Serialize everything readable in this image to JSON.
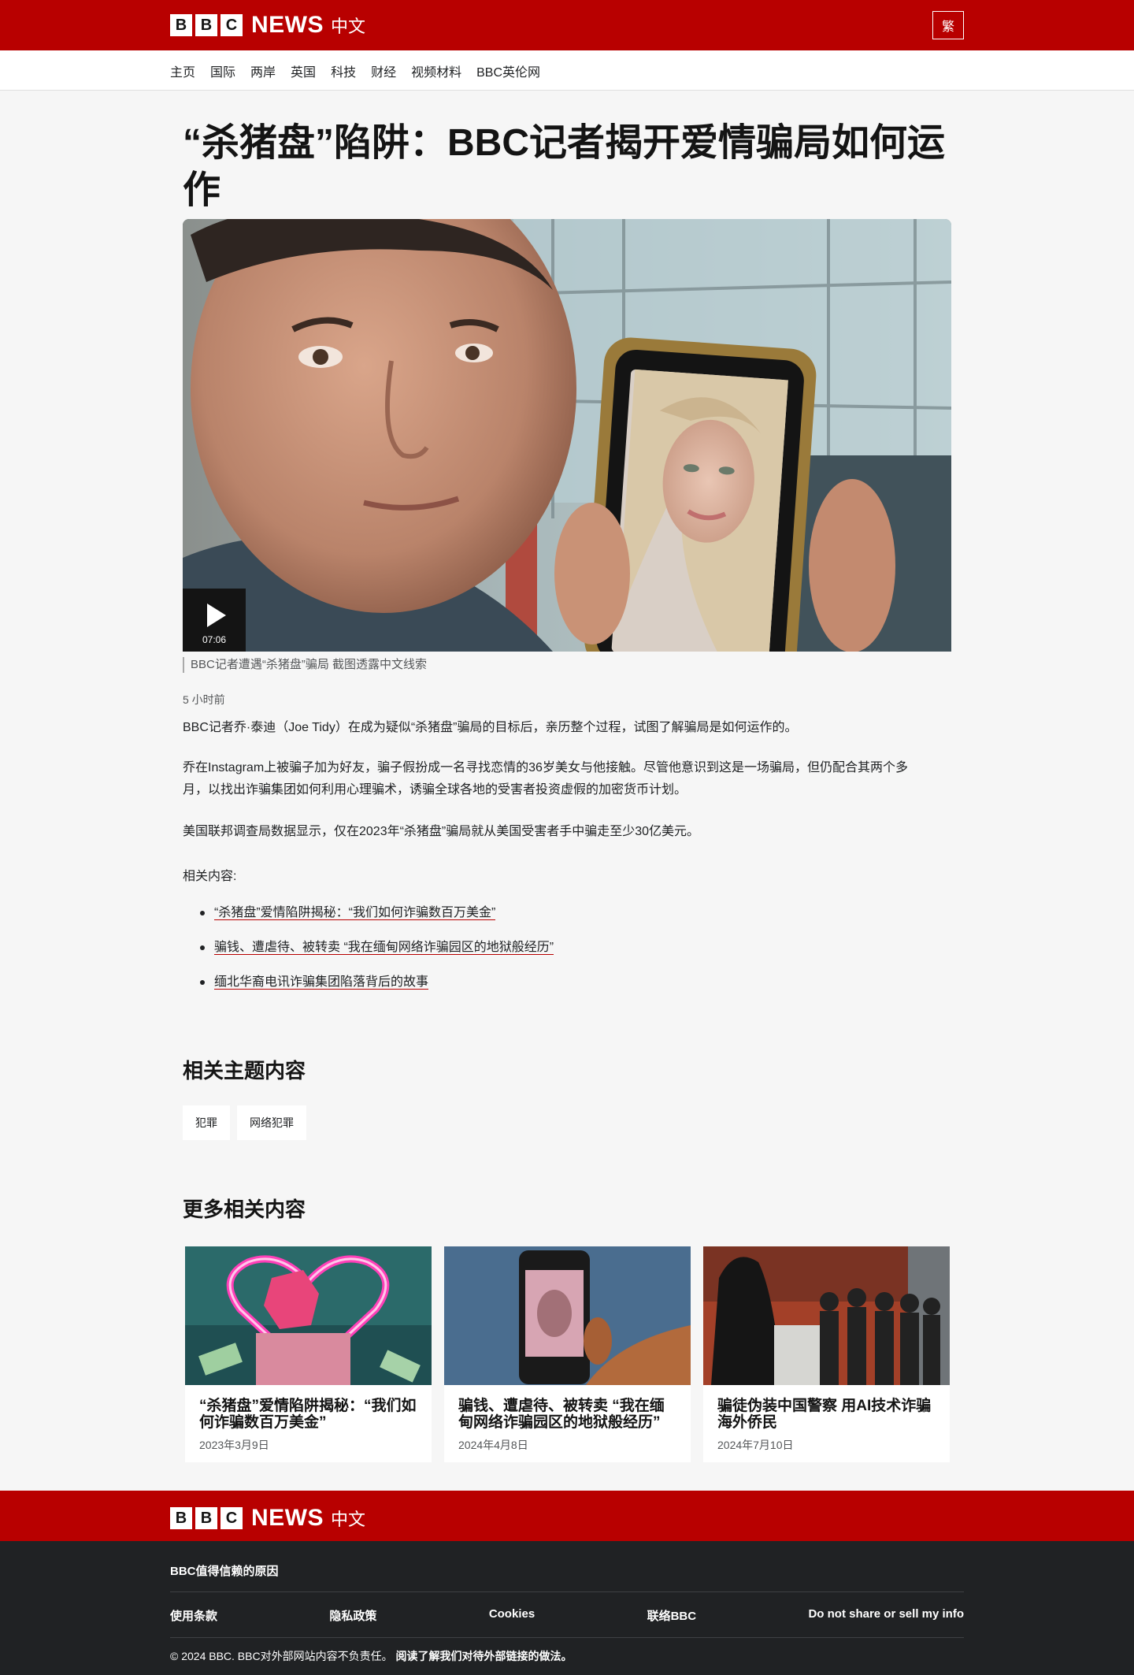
{
  "header": {
    "bbc_letters": [
      "B",
      "B",
      "C"
    ],
    "news": "NEWS",
    "language": "中文",
    "traditional_toggle": "繁"
  },
  "nav": {
    "items": [
      "主页",
      "国际",
      "两岸",
      "英国",
      "科技",
      "财经",
      "视频材料",
      "BBC英伦网"
    ]
  },
  "article": {
    "headline": "“杀猪盘”陷阱：BBC记者揭开爱情骗局如何运作",
    "video_duration": "07:06",
    "caption": "BBC记者遭遇“杀猪盘”骗局 截图透露中文线索",
    "timestamp": "5 小时前",
    "paragraphs": [
      "BBC记者乔·泰迪（Joe Tidy）在成为疑似“杀猪盘”骗局的目标后，亲历整个过程，试图了解骗局是如何运作的。",
      "乔在Instagram上被骗子加为好友，骗子假扮成一名寻找恋情的36岁美女与他接触。尽管他意识到这是一场骗局，但仍配合其两个多月，以找出诈骗集团如何利用心理骗术，诱骗全球各地的受害者投资虚假的加密货币计划。",
      "美国联邦调查局数据显示，仅在2023年“杀猪盘”骗局就从美国受害者手中骗走至少30亿美元。"
    ],
    "related_label": "相关内容:",
    "related_links": [
      "“杀猪盘”爱情陷阱揭秘：“我们如何诈骗数百万美金”",
      "骗钱、遭虐待、被转卖 “我在缅甸网络诈骗园区的地狱般经历”",
      "缅北华裔电讯诈骗集团陷落背后的故事"
    ]
  },
  "topics": {
    "title": "相关主题内容",
    "tags": [
      "犯罪",
      "网络犯罪"
    ]
  },
  "more": {
    "title": "更多相关内容",
    "cards": [
      {
        "title": "“杀猪盘”爱情陷阱揭秘：“我们如何诈骗数百万美金”",
        "date": "2023年3月9日"
      },
      {
        "title": "骗钱、遭虐待、被转卖 “我在缅甸网络诈骗园区的地狱般经历”",
        "date": "2024年4月8日"
      },
      {
        "title": "骗徒伪装中国警察 用AI技术诈骗海外侨民",
        "date": "2024年7月10日"
      }
    ]
  },
  "footer": {
    "trust": "BBC值得信赖的原因",
    "links": [
      "使用条款",
      "隐私政策",
      "Cookies",
      "联络BBC",
      "Do not share or sell my info"
    ],
    "copyright": "© 2024 BBC. BBC对外部网站内容不负责任。",
    "external_link": "阅读了解我们对待外部链接的做法。"
  },
  "colors": {
    "brand_red": "#b80000",
    "footer_dark": "#202224",
    "page_bg": "#f6f6f6"
  }
}
